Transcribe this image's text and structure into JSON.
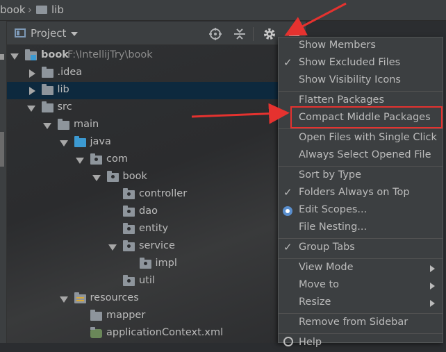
{
  "breadcrumb": {
    "project": "book",
    "folder": "lib"
  },
  "panel": {
    "view_label": "Project",
    "icons": [
      "locate-icon",
      "collapse-icon",
      "gear-icon",
      "minimize-icon"
    ]
  },
  "tree": [
    {
      "label": "book",
      "path": " F:\\IntellijTry\\book",
      "depth": 0,
      "arrow": "down",
      "icon": "module"
    },
    {
      "label": ".idea",
      "depth": 1,
      "arrow": "right",
      "icon": "folder"
    },
    {
      "label": "lib",
      "depth": 1,
      "arrow": "right",
      "icon": "folder",
      "selected": true
    },
    {
      "label": "src",
      "depth": 1,
      "arrow": "down",
      "icon": "folder"
    },
    {
      "label": "main",
      "depth": 2,
      "arrow": "down",
      "icon": "folder"
    },
    {
      "label": "java",
      "depth": 3,
      "arrow": "down",
      "icon": "source"
    },
    {
      "label": "com",
      "depth": 4,
      "arrow": "down",
      "icon": "package"
    },
    {
      "label": "book",
      "depth": 5,
      "arrow": "down",
      "icon": "package"
    },
    {
      "label": "controller",
      "depth": 6,
      "arrow": "none",
      "icon": "package"
    },
    {
      "label": "dao",
      "depth": 6,
      "arrow": "none",
      "icon": "package"
    },
    {
      "label": "entity",
      "depth": 6,
      "arrow": "none",
      "icon": "package"
    },
    {
      "label": "service",
      "depth": 6,
      "arrow": "down",
      "icon": "package"
    },
    {
      "label": "impl",
      "depth": 7,
      "arrow": "none",
      "icon": "package"
    },
    {
      "label": "util",
      "depth": 6,
      "arrow": "none",
      "icon": "package"
    },
    {
      "label": "resources",
      "depth": 3,
      "arrow": "down",
      "icon": "resources"
    },
    {
      "label": "mapper",
      "depth": 4,
      "arrow": "none",
      "icon": "folder"
    },
    {
      "label": "applicationContext.xml",
      "depth": 4,
      "arrow": "none",
      "icon": "spring-xml"
    }
  ],
  "menu": {
    "groups": [
      [
        {
          "label": "Show Members",
          "check": false
        },
        {
          "label": "Show Excluded Files",
          "check": true
        },
        {
          "label": "Show Visibility Icons",
          "check": false
        }
      ],
      [
        {
          "label": "Flatten Packages",
          "check": false
        },
        {
          "label": "Compact Middle Packages",
          "check": false,
          "highlighted": true
        }
      ],
      [
        {
          "label": "Open Files with Single Click",
          "check": false
        },
        {
          "label": "Always Select Opened File",
          "check": false
        }
      ],
      [
        {
          "label": "Sort by Type",
          "check": false
        },
        {
          "label": "Folders Always on Top",
          "check": true
        },
        {
          "label": "Edit Scopes...",
          "radio": true
        },
        {
          "label": "File Nesting...",
          "check": false
        }
      ],
      [
        {
          "label": "Group Tabs",
          "check": true
        }
      ],
      [
        {
          "label": "View Mode",
          "submenu": true
        },
        {
          "label": "Move to",
          "submenu": true
        },
        {
          "label": "Resize",
          "submenu": true
        }
      ],
      [
        {
          "label": "Remove from Sidebar"
        }
      ],
      [
        {
          "label": "Help"
        }
      ]
    ]
  },
  "colors": {
    "accent_red": "#e5322f",
    "selection": "#0d293e",
    "source_folder": "#3c9ad2"
  }
}
